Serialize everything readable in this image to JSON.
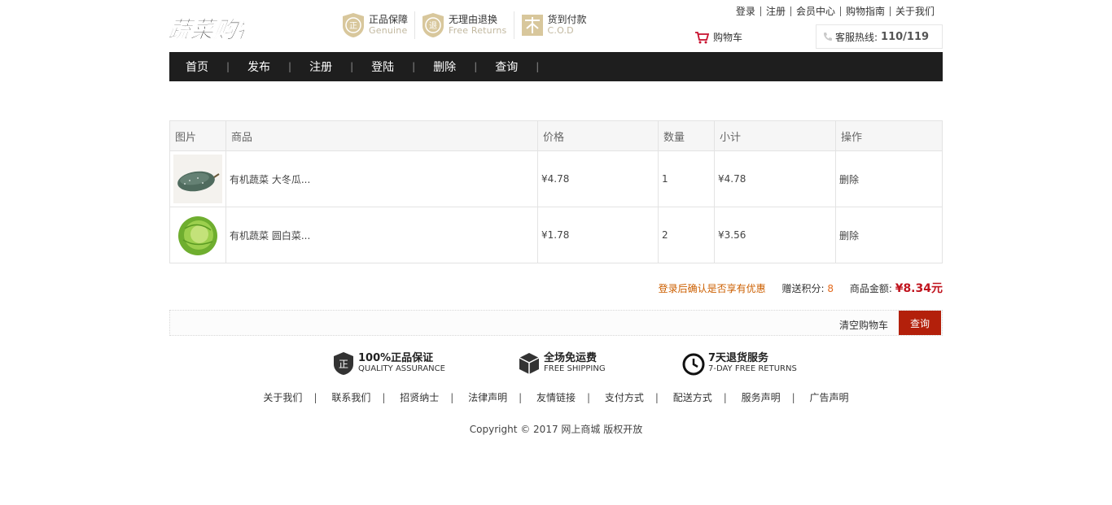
{
  "header": {
    "logo_text": "蔬菜购物",
    "badges": [
      {
        "title": "正品保障",
        "sub": "Genuine",
        "icon": "genuine-shield-icon"
      },
      {
        "title": "无理由退换",
        "sub": "Free Returns",
        "icon": "return-shield-icon"
      },
      {
        "title": "货到付款",
        "sub": "C.O.D",
        "icon": "cod-icon"
      }
    ],
    "top_links": [
      "登录",
      "注册",
      "会员中心",
      "购物指南",
      "关于我们"
    ],
    "cart_label": "购物车",
    "hotline_label": "客服热线:",
    "hotline_number": "110/119"
  },
  "nav": {
    "items": [
      "首页",
      "发布",
      "注册",
      "登陆",
      "删除",
      "查询"
    ]
  },
  "table": {
    "headers": [
      "图片",
      "商品",
      "价格",
      "数量",
      "小计",
      "操作"
    ],
    "rows": [
      {
        "name": "有机蔬菜 大冬瓜...",
        "price": "¥4.78",
        "qty": "1",
        "subtotal": "¥4.78",
        "action": "删除",
        "image": "winter-melon"
      },
      {
        "name": "有机蔬菜 圆白菜...",
        "price": "¥1.78",
        "qty": "2",
        "subtotal": "¥3.56",
        "action": "删除",
        "image": "cabbage"
      }
    ]
  },
  "summary": {
    "login_tip": "登录后确认是否享有优惠",
    "points_label": "赠送积分:",
    "points": "8",
    "amount_label": "商品金额:",
    "amount": "¥8.34元"
  },
  "actions": {
    "clear_label": "清空购物车",
    "query_label": "查询"
  },
  "services": [
    {
      "title": "100%正品保证",
      "sub": "QUALITY ASSURANCE",
      "icon": "quality-shield-icon"
    },
    {
      "title": "全场免运费",
      "sub": "FREE SHIPPING",
      "icon": "box-icon"
    },
    {
      "title": "7天退货服务",
      "sub": "7-DAY FREE RETURNS",
      "icon": "clock-icon"
    }
  ],
  "footer": {
    "links": [
      "关于我们",
      "联系我们",
      "招贤纳士",
      "法律声明",
      "友情链接",
      "支付方式",
      "配送方式",
      "服务声明",
      "广告声明"
    ],
    "copyright": "Copyright © 2017 网上商城 版权开放"
  }
}
